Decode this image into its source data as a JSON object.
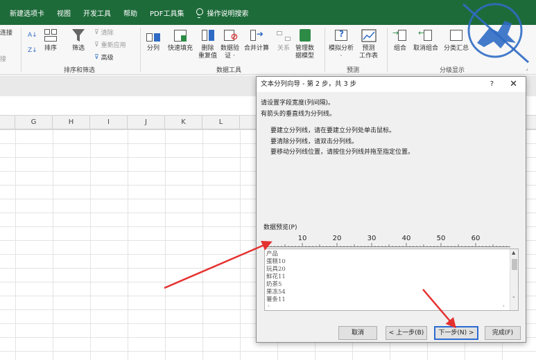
{
  "tabs": [
    "新建选项卡",
    "视图",
    "开发工具",
    "帮助",
    "PDF工具集",
    "操作说明搜索"
  ],
  "ribbon": {
    "left_partial": [
      "连接",
      "接"
    ],
    "sort_filter": {
      "sort_asc": "A↓",
      "sort_desc": "Z↓",
      "sort_label": "排序",
      "filter_label": "筛选",
      "clear_label": "清除",
      "reapply_label": "重新应用",
      "advanced_label": "高级",
      "group_label": "排序和筛选"
    },
    "data_tools": {
      "split_label": "分列",
      "flash_fill_label": "快速填充",
      "remove_dup_label_1": "删除",
      "remove_dup_label_2": "重复值",
      "validation_label_1": "数据验",
      "validation_label_2": "证 ·",
      "consolidate_label": "合并计算",
      "relations_label": "关系",
      "model_label_1": "管理数",
      "model_label_2": "据模型",
      "group_label": "数据工具"
    },
    "forecast": {
      "whatif_label_1": "模拟分析",
      "whatif_label_2": "·",
      "sheet_label_1": "预测",
      "sheet_label_2": "工作表",
      "group_label": "预测"
    },
    "outline": {
      "group_btn_label": "组合",
      "ungroup_label": "取消组合",
      "subtotal_label": "分类汇总",
      "group_label": "分级显示"
    }
  },
  "columns": [
    "G",
    "H",
    "I",
    "J",
    "K",
    "L"
  ],
  "dialog": {
    "title": "文本分列向导 - 第 2 步，共 3 步",
    "help": "?",
    "close": "✕",
    "intro_1": "请设置字段宽度(列间隔)。",
    "intro_2": "有箭头的垂直线为分列线。",
    "hint_1": "要建立分列线，请在要建立分列处单击鼠标。",
    "hint_2": "要清除分列线，请双击分列线。",
    "hint_3": "要移动分列线位置，请按住分列线并拖至指定位置。",
    "preview_label": "数据预览(P)",
    "ruler": [
      "10",
      "20",
      "30",
      "40",
      "50",
      "60"
    ],
    "rows": [
      "产品",
      "蛋糕10",
      "玩具20",
      "鲜花11",
      "奶茶5",
      "果冻54",
      "薯条11"
    ],
    "cancel": "取消",
    "back": "< 上一步(B)",
    "next": "下一步(N) >",
    "finish": "完成(F)"
  },
  "colors": {
    "accent": "#1e6b3a",
    "arrow": "#e53030",
    "focus": "#2c6ad2"
  }
}
